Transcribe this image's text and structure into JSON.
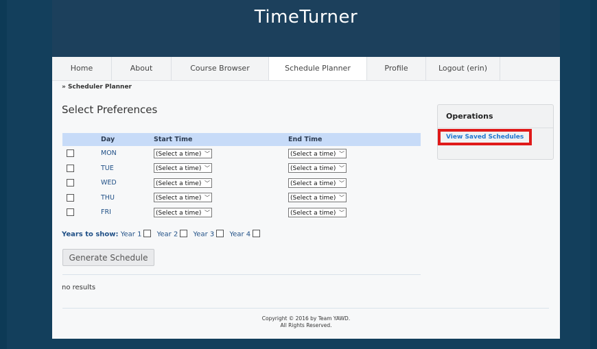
{
  "site": {
    "title": "TimeTurner"
  },
  "nav": {
    "items": [
      {
        "label": "Home"
      },
      {
        "label": "About"
      },
      {
        "label": "Course Browser"
      },
      {
        "label": "Schedule Planner"
      },
      {
        "label": "Profile"
      },
      {
        "label": "Logout (erin)"
      }
    ],
    "active_index": 3
  },
  "breadcrumb": "» Scheduler Planner",
  "preferences": {
    "title": "Select Preferences",
    "headers": {
      "day": "Day",
      "start": "Start Time",
      "end": "End Time"
    },
    "rows": [
      {
        "day": "MON",
        "start": "(Select a time)",
        "end": "(Select a time)"
      },
      {
        "day": "TUE",
        "start": "(Select a time)",
        "end": "(Select a time)"
      },
      {
        "day": "WED",
        "start": "(Select a time)",
        "end": "(Select a time)"
      },
      {
        "day": "THU",
        "start": "(Select a time)",
        "end": "(Select a time)"
      },
      {
        "day": "FRI",
        "start": "(Select a time)",
        "end": "(Select a time)"
      }
    ],
    "years_label": "Years to show:",
    "years": [
      "Year 1",
      "Year 2",
      "Year 3",
      "Year 4"
    ],
    "generate_label": "Generate Schedule",
    "results_text": "no results"
  },
  "operations": {
    "title": "Operations",
    "link_label": "View Saved Schedules",
    "highlight_color": "#e01a1a"
  },
  "footer": {
    "line1": "Copyright © 2016 by Team YAWD.",
    "line2": "All Rights Reserved."
  },
  "colors": {
    "background": "#0d3a56",
    "header": "#1c405c",
    "table_header": "#c7dbf8",
    "link": "#1f77d0"
  }
}
